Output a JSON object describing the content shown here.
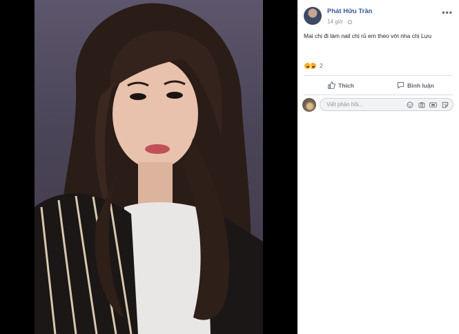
{
  "post": {
    "author": "Phát Hữu Trần",
    "time": "14 giờ",
    "text": "Mai chị đi làm nail chị rủ em theo với nha chị Lựu",
    "more": "•••"
  },
  "reactions": {
    "icons": [
      "haha-icon",
      "wow-icon"
    ],
    "count": "2"
  },
  "actions": {
    "like_label": "Thích",
    "comment_label": "Bình luận"
  },
  "comment": {
    "placeholder": "Viết phản hồi...",
    "icons": [
      "emoji-icon",
      "camera-icon",
      "gif-icon",
      "sticker-icon"
    ]
  },
  "colors": {
    "author": "#385898",
    "text": "#1d2129",
    "muted": "#90949c",
    "viewer_bg": "#000000"
  }
}
